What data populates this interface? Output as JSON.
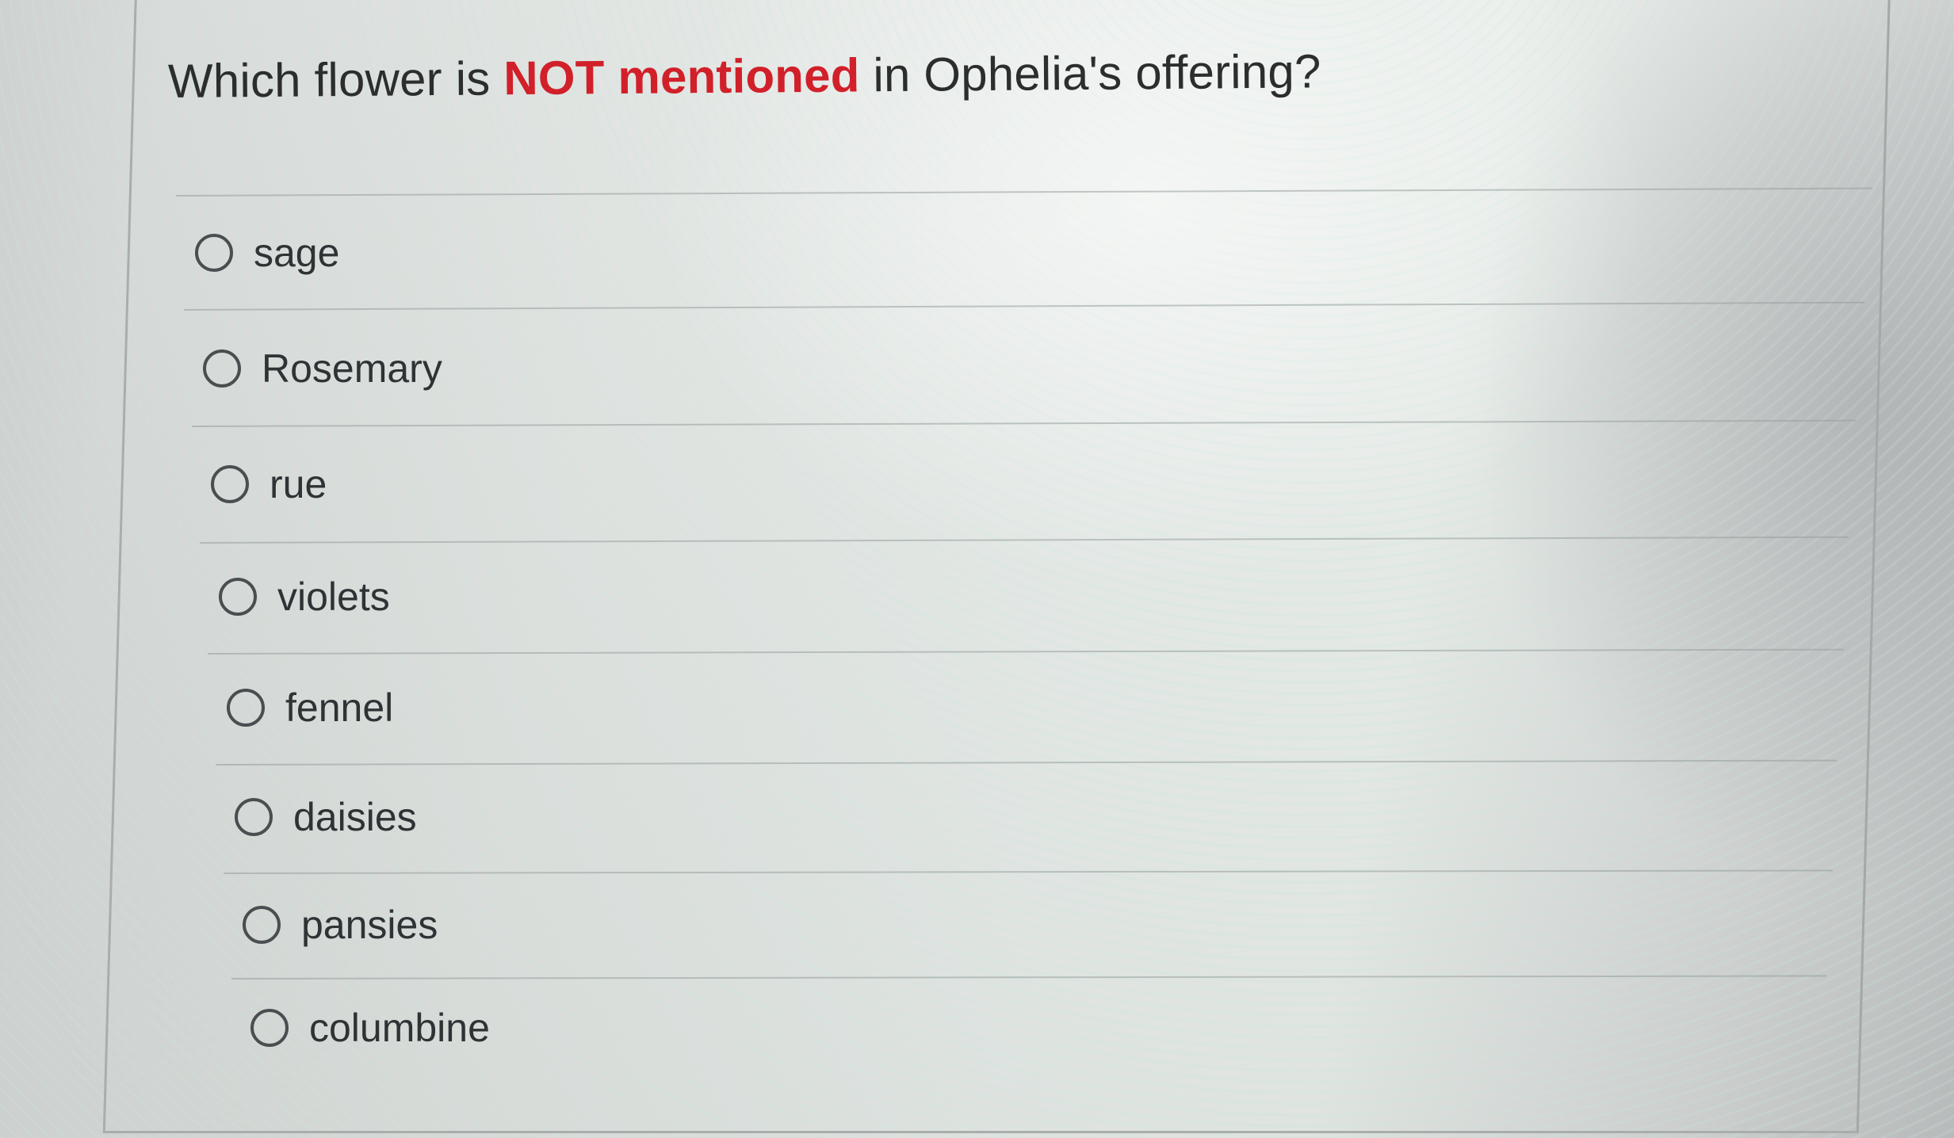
{
  "question": {
    "prefix": "Which flower is ",
    "emphasis": "NOT mentioned",
    "suffix": " in Ophelia's offering?",
    "emphasis_color": "#d1202a"
  },
  "options": [
    {
      "label": "sage",
      "selected": false
    },
    {
      "label": "Rosemary",
      "selected": false
    },
    {
      "label": "rue",
      "selected": false
    },
    {
      "label": "violets",
      "selected": false
    },
    {
      "label": "fennel",
      "selected": false
    },
    {
      "label": "daisies",
      "selected": false
    },
    {
      "label": "pansies",
      "selected": false
    },
    {
      "label": "columbine",
      "selected": false
    }
  ]
}
